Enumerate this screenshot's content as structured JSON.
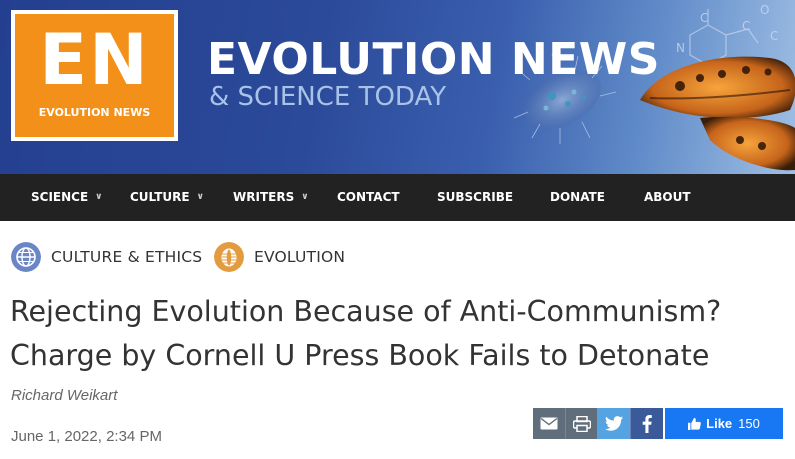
{
  "site": {
    "logo_letters": "EN",
    "logo_subtext": "EVOLUTION NEWS",
    "title": "EVOLUTION NEWS",
    "subtitle": "& SCIENCE TODAY"
  },
  "nav": {
    "items": [
      {
        "label": "SCIENCE",
        "has_dropdown": true
      },
      {
        "label": "CULTURE",
        "has_dropdown": true
      },
      {
        "label": "WRITERS",
        "has_dropdown": true
      },
      {
        "label": "CONTACT",
        "has_dropdown": false
      },
      {
        "label": "SUBSCRIBE",
        "has_dropdown": false
      },
      {
        "label": "DONATE",
        "has_dropdown": false
      },
      {
        "label": "ABOUT",
        "has_dropdown": false
      }
    ],
    "dropdown_icon": "chevron-down-icon"
  },
  "categories": [
    {
      "label": "CULTURE & ETHICS",
      "icon": "globe-icon",
      "color": "#6b86c7"
    },
    {
      "label": "EVOLUTION",
      "icon": "trilobite-icon",
      "color": "#e39b40"
    }
  ],
  "article": {
    "headline": "Rejecting Evolution Because of Anti-Communism? Charge by Cornell U Press Book Fails to Detonate",
    "author": "Richard Weikart",
    "date": "June 1, 2022, 2:34 PM"
  },
  "share": {
    "buttons": [
      {
        "icon": "email-icon",
        "color": "#5f6e7a"
      },
      {
        "icon": "print-icon",
        "color": "#5f6e7a"
      },
      {
        "icon": "twitter-icon",
        "color": "#55a3e0"
      },
      {
        "icon": "facebook-icon",
        "color": "#3b5a99"
      }
    ],
    "like": {
      "label": "Like",
      "count": "150",
      "icon": "thumbs-up-icon",
      "color": "#1877f2"
    }
  },
  "colors": {
    "banner": "#2c4a9a",
    "logo_orange": "#f39019",
    "nav_bg": "#222222",
    "text": "#333333",
    "meta_text": "#666666"
  }
}
